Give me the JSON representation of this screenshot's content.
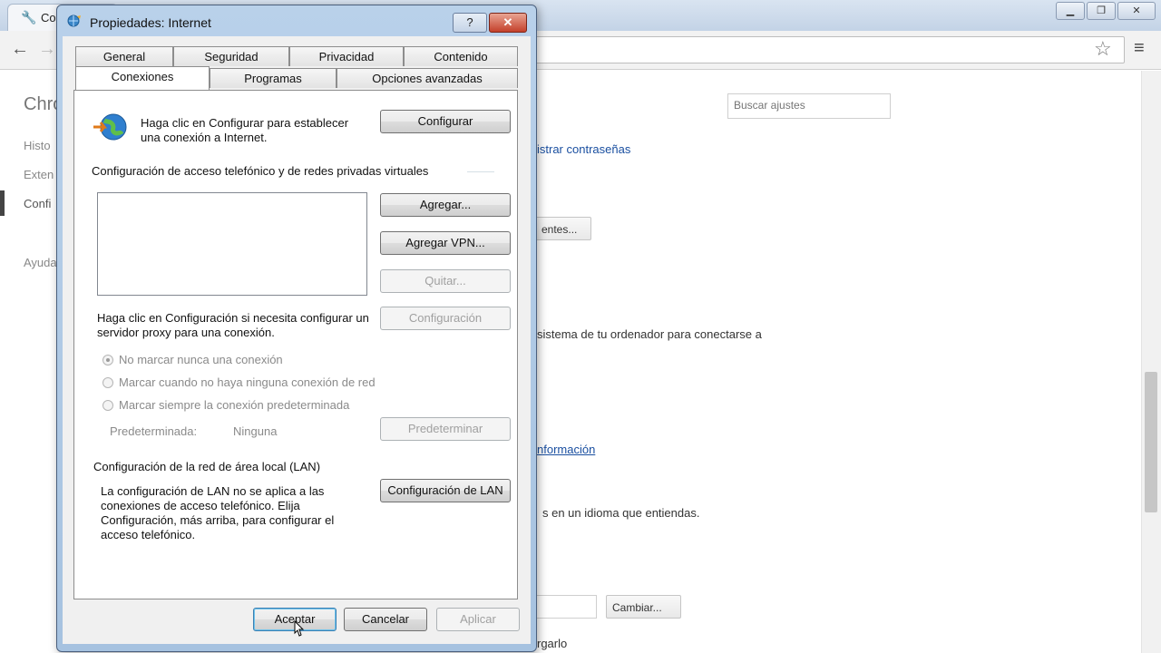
{
  "chrome": {
    "tab_title": "Co",
    "sidebar_title": "Chro",
    "sidebar_items": [
      "Histo",
      "Exten",
      "Confi",
      "Ayuda"
    ],
    "search_placeholder": "Buscar ajustes",
    "background": {
      "link_passwords": "istrar contraseñas",
      "btn_certificates": "entes...",
      "text_system": "sistema de tu ordenador para conectarse a",
      "link_info": "nformación",
      "text_language": "s en un idioma que entiendas.",
      "btn_change": "Cambiar...",
      "text_download": "rgarlo"
    }
  },
  "dialog": {
    "title": "Propiedades: Internet",
    "help_label": "?",
    "close_label": "✕",
    "tabs_row1": [
      "General",
      "Seguridad",
      "Privacidad",
      "Contenido"
    ],
    "tabs_row2": [
      "Conexiones",
      "Programas",
      "Opciones avanzadas"
    ],
    "active_tab": "Conexiones",
    "setup_text": "Haga clic en Configurar para establecer una conexión a Internet.",
    "setup_button": "Configurar",
    "dialup_heading": "Configuración de acceso telefónico y de redes privadas virtuales",
    "add_button": "Agregar...",
    "add_vpn_button": "Agregar VPN...",
    "remove_button": "Quitar...",
    "proxy_text": "Haga clic en Configuración si necesita configurar un servidor proxy para una conexión.",
    "settings_button": "Configuración",
    "radios": [
      {
        "label": "No marcar nunca una conexión",
        "selected": true
      },
      {
        "label": "Marcar cuando no haya ninguna conexión de red",
        "selected": false
      },
      {
        "label": "Marcar siempre la conexión predeterminada",
        "selected": false
      }
    ],
    "default_label": "Predeterminada:",
    "default_value": "Ninguna",
    "set_default_button": "Predeterminar",
    "lan_heading": "Configuración de la red de área local (LAN)",
    "lan_text": "La configuración de LAN no se aplica a las conexiones de acceso telefónico. Elija Configuración, más arriba, para configurar el acceso telefónico.",
    "lan_button": "Configuración de LAN",
    "ok_button": "Aceptar",
    "cancel_button": "Cancelar",
    "apply_button": "Aplicar"
  }
}
